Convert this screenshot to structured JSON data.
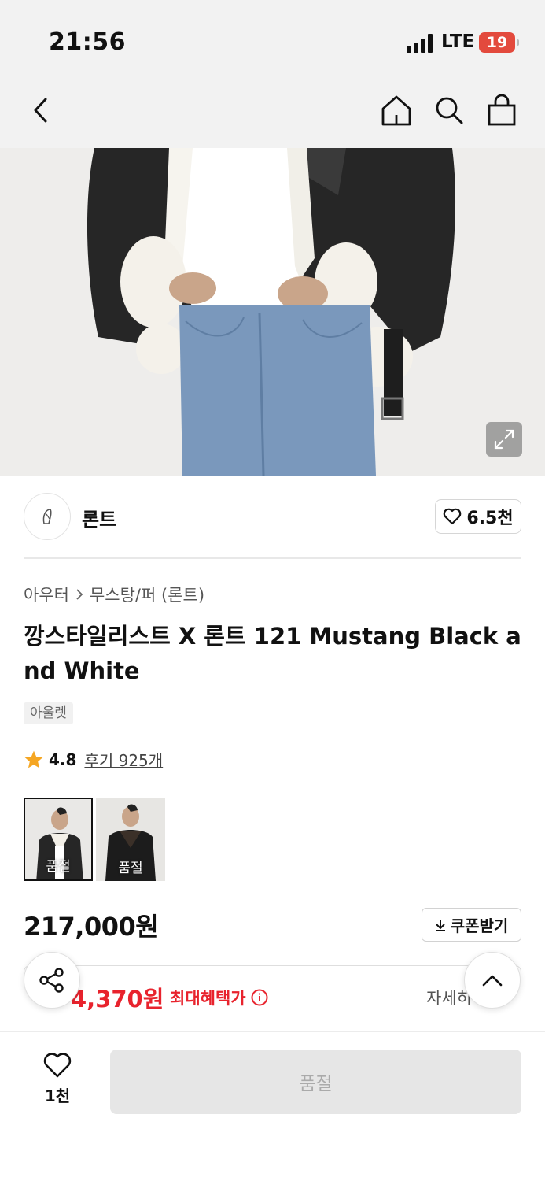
{
  "status_bar": {
    "time": "21:56",
    "network": "LTE",
    "battery": "19"
  },
  "nav": {
    "back": "chevron-left-icon",
    "home": "home-icon",
    "search": "search-icon",
    "cart": "bag-icon"
  },
  "brand": {
    "name": "론트",
    "like_count": "6.5천"
  },
  "breadcrumb": {
    "category": "아우터",
    "subcategory": "무스탕/퍼 (론트)"
  },
  "product": {
    "title": "깡스타일리스트 X 론트 121 Mustang Black and White",
    "tag": "아울렛",
    "rating": "4.8",
    "reviews": "후기 925개",
    "options": [
      {
        "label": "품절",
        "selected": true
      },
      {
        "label": "품절",
        "selected": false
      }
    ],
    "price": "217,000원",
    "coupon_label": "쿠폰받기"
  },
  "benefit": {
    "price": "4,370원",
    "label": "최대혜택가",
    "detail": "자세히"
  },
  "bottom": {
    "wish_count": "1천",
    "buy_label": "품절"
  },
  "colors": {
    "accent_red": "#e8232d",
    "battery_red": "#e34a3d",
    "star": "#f5a623"
  }
}
